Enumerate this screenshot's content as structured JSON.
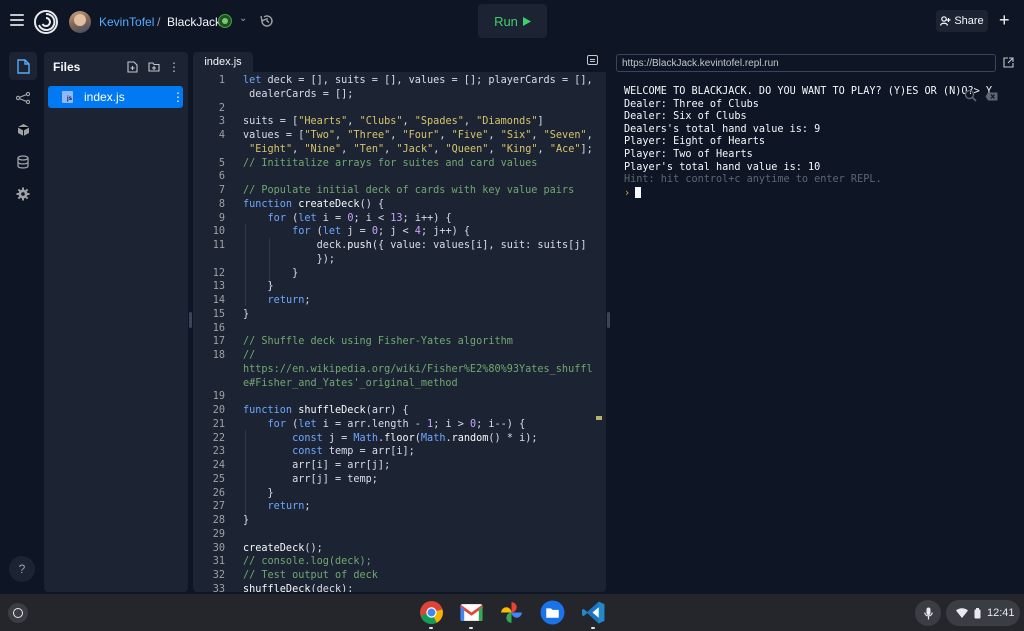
{
  "header": {
    "owner": "KevinTofel",
    "separator": "/",
    "repl_name": "BlackJack",
    "run_label": "Run",
    "share_label": "Share"
  },
  "files_panel": {
    "title": "Files",
    "files": [
      {
        "name": "index.js"
      }
    ]
  },
  "editor": {
    "tab_label": "index.js",
    "lines": [
      {
        "n": "1",
        "t": "let deck = [], suits = [], values = []; playerCards = [],"
      },
      {
        "n": "",
        "t": " dealerCards = [];"
      },
      {
        "n": "2",
        "t": ""
      },
      {
        "n": "3",
        "t": "suits = [\"Hearts\", \"Clubs\", \"Spades\", \"Diamonds\"]"
      },
      {
        "n": "4",
        "t": "values = [\"Two\", \"Three\", \"Four\", \"Five\", \"Six\", \"Seven\","
      },
      {
        "n": "",
        "t": " \"Eight\", \"Nine\", \"Ten\", \"Jack\", \"Queen\", \"King\", \"Ace\"];"
      },
      {
        "n": "5",
        "t": "// Inititalize arrays for suites and card values"
      },
      {
        "n": "6",
        "t": ""
      },
      {
        "n": "7",
        "t": "// Populate initial deck of cards with key value pairs"
      },
      {
        "n": "8",
        "t": "function createDeck() {"
      },
      {
        "n": "9",
        "t": "    for (let i = 0; i < 13; i++) {"
      },
      {
        "n": "10",
        "t": "        for (let j = 0; j < 4; j++) {"
      },
      {
        "n": "11",
        "t": "            deck.push({ value: values[i], suit: suits[j]"
      },
      {
        "n": "",
        "t": "            });"
      },
      {
        "n": "12",
        "t": "        }"
      },
      {
        "n": "13",
        "t": "    }"
      },
      {
        "n": "14",
        "t": "    return;"
      },
      {
        "n": "15",
        "t": "}"
      },
      {
        "n": "16",
        "t": ""
      },
      {
        "n": "17",
        "t": "// Shuffle deck using Fisher-Yates algorithm"
      },
      {
        "n": "18",
        "t": "//"
      },
      {
        "n": "",
        "t": "https://en.wikipedia.org/wiki/Fisher%E2%80%93Yates_shuffl"
      },
      {
        "n": "",
        "t": "e#Fisher_and_Yates'_original_method"
      },
      {
        "n": "19",
        "t": ""
      },
      {
        "n": "20",
        "t": "function shuffleDeck(arr) {"
      },
      {
        "n": "21",
        "t": "    for (let i = arr.length - 1; i > 0; i--) {"
      },
      {
        "n": "22",
        "t": "        const j = Math.floor(Math.random() * i);"
      },
      {
        "n": "23",
        "t": "        const temp = arr[i];"
      },
      {
        "n": "24",
        "t": "        arr[i] = arr[j];"
      },
      {
        "n": "25",
        "t": "        arr[j] = temp;"
      },
      {
        "n": "26",
        "t": "    }"
      },
      {
        "n": "27",
        "t": "    return;"
      },
      {
        "n": "28",
        "t": "}"
      },
      {
        "n": "29",
        "t": ""
      },
      {
        "n": "30",
        "t": "createDeck();"
      },
      {
        "n": "31",
        "t": "// console.log(deck);"
      },
      {
        "n": "32",
        "t": "// Test output of deck"
      },
      {
        "n": "33",
        "t": "shuffleDeck(deck);"
      }
    ]
  },
  "console": {
    "url": "https://BlackJack.kevintofel.repl.run",
    "output": [
      "WELCOME TO BLACKJACK. DO YOU WANT TO PLAY? (Y)ES OR (N)O?> Y",
      "Dealer: Three of Clubs",
      "Dealer: Six of Clubs",
      "Dealers's total hand value is: 9",
      "Player: Eight of Hearts",
      "Player: Two of Hearts",
      "Player's total hand value is: 10"
    ],
    "hint": "Hint: hit control+c anytime to enter REPL.",
    "prompt_symbol": "›"
  },
  "taskbar": {
    "apps": [
      "chrome-icon",
      "gmail-icon",
      "photos-icon",
      "files-icon",
      "vscode-icon"
    ],
    "time": "12:41"
  },
  "colors": {
    "accent_blue": "#0079f2",
    "run_green": "#3ecf6a",
    "background": "#0e1525",
    "surface": "#1c2333"
  }
}
